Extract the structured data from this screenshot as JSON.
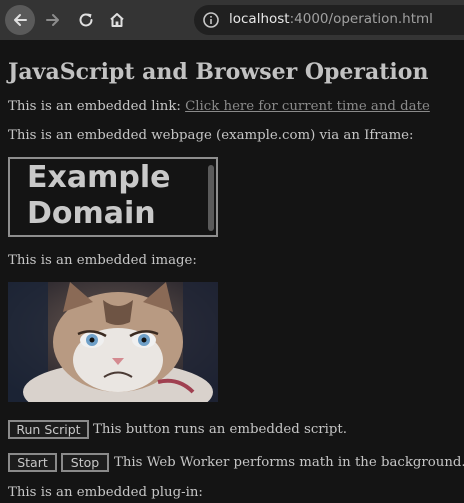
{
  "browser": {
    "url_host": "localhost",
    "url_path": ":4000/operation.html",
    "icons": [
      "back-arrow-icon",
      "forward-arrow-icon",
      "reload-icon",
      "home-icon",
      "info-icon"
    ]
  },
  "page": {
    "title": "JavaScript and Browser Operation",
    "link_prefix": "This is an embedded link: ",
    "link_text": "Click here for current time and date",
    "iframe_caption": "This is an embedded webpage (example.com) via an Iframe:",
    "iframe_content": "Example Domain",
    "image_caption": "This is an embedded image:",
    "run_script_label": "Run Script",
    "run_script_desc": "This button runs an embedded script.",
    "start_label": "Start",
    "stop_label": "Stop",
    "worker_desc": "This Web Worker performs math in the background.",
    "plugin_caption": "This is an embedded plug-in:"
  },
  "colors": {
    "toolbar": "#343434",
    "page_bg": "#141414",
    "text": "#c6c6c6",
    "link": "#8a8a8a"
  }
}
